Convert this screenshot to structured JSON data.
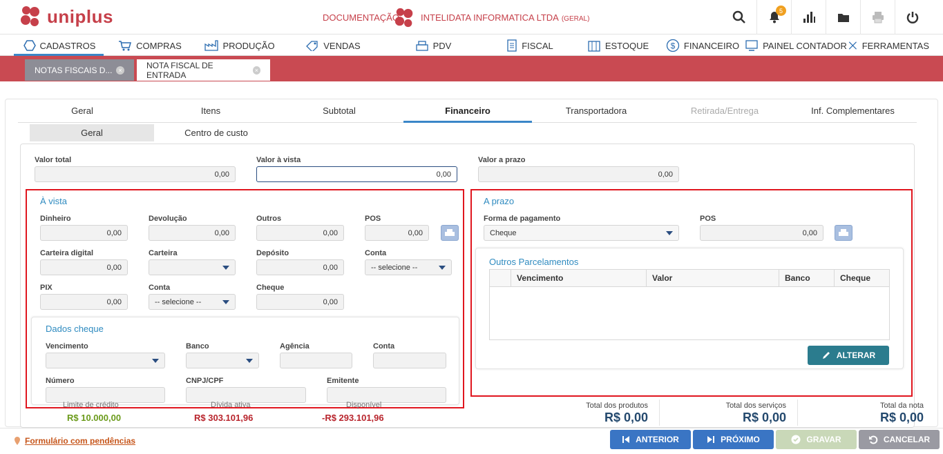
{
  "header": {
    "logo": "uniplus",
    "documentation": "DOCUMENTAÇÃO",
    "company": "INTELIDATA INFORMATICA LTDA",
    "company_tag": "(GERAL)",
    "notifications": "5"
  },
  "menu": [
    {
      "label": "CADASTROS",
      "icon": "hexagon-icon"
    },
    {
      "label": "COMPRAS",
      "icon": "cart-icon"
    },
    {
      "label": "PRODUÇÃO",
      "icon": "factory-icon"
    },
    {
      "label": "VENDAS",
      "icon": "tag-icon"
    },
    {
      "label": "PDV",
      "icon": "cash-register-icon"
    },
    {
      "label": "FISCAL",
      "icon": "document-icon"
    },
    {
      "label": "ESTOQUE",
      "icon": "box-icon"
    },
    {
      "label": "FINANCEIRO",
      "icon": "dollar-icon"
    },
    {
      "label": "PAINEL CONTADOR",
      "icon": "monitor-icon"
    },
    {
      "label": "FERRAMENTAS",
      "icon": "tools-icon"
    }
  ],
  "doc_tabs": {
    "inactive": "NOTAS FISCAIS D...",
    "active": "NOTA FISCAL DE ENTRADA"
  },
  "form_tabs": [
    "Geral",
    "Itens",
    "Subtotal",
    "Financeiro",
    "Transportadora",
    "Retirada/Entrega",
    "Inf. Complementares"
  ],
  "sub_tabs": [
    "Geral",
    "Centro de custo"
  ],
  "top_values": {
    "valor_total_label": "Valor total",
    "valor_total": "0,00",
    "valor_vista_label": "Valor à vista",
    "valor_vista": "0,00",
    "valor_prazo_label": "Valor a prazo",
    "valor_prazo": "0,00"
  },
  "avista": {
    "title": "À vista",
    "dinheiro_label": "Dinheiro",
    "dinheiro": "0,00",
    "devolucao_label": "Devolução",
    "devolucao": "0,00",
    "outros_label": "Outros",
    "outros": "0,00",
    "pos_label": "POS",
    "pos": "0,00",
    "carteira_digital_label": "Carteira digital",
    "carteira_digital": "0,00",
    "carteira_label": "Carteira",
    "deposito_label": "Depósito",
    "deposito": "0,00",
    "conta_label": "Conta",
    "conta": "-- selecione --",
    "pix_label": "PIX",
    "pix": "0,00",
    "conta2_label": "Conta",
    "conta2": "-- selecione --",
    "cheque_label": "Cheque",
    "cheque": "0,00"
  },
  "dados_cheque": {
    "title": "Dados cheque",
    "vencimento": "Vencimento",
    "banco": "Banco",
    "agencia": "Agência",
    "conta": "Conta",
    "numero": "Número",
    "cnpj": "CNPJ/CPF",
    "emitente": "Emitente"
  },
  "credit": {
    "limite_label": "Limite de crédito",
    "limite": "R$ 10.000,00",
    "divida_label": "Dívida ativa",
    "divida": "R$ 303.101,96",
    "disponivel_label": "Disponível",
    "disponivel": "-R$ 293.101,96"
  },
  "aprazo": {
    "title": "A prazo",
    "forma_label": "Forma de pagamento",
    "forma": "Cheque",
    "pos_label": "POS",
    "pos": "0,00",
    "outros_title": "Outros Parcelamentos",
    "columns": [
      "Vencimento",
      "Valor",
      "Banco",
      "Cheque"
    ],
    "alterar": "ALTERAR"
  },
  "totals": {
    "produtos_label": "Total dos produtos",
    "produtos": "R$ 0,00",
    "servicos_label": "Total dos serviços",
    "servicos": "R$ 0,00",
    "nota_label": "Total da nota",
    "nota": "R$ 0,00"
  },
  "footer": {
    "pendencias": "Formulário com pendências",
    "anterior": "ANTERIOR",
    "proximo": "PRÓXIMO",
    "gravar": "GRAVAR",
    "cancelar": "CANCELAR"
  },
  "colors": {
    "brand": "#c6404a",
    "tab_bar": "#c94a52",
    "section_title": "#2f8bc0",
    "button_primary": "#3a75c4",
    "button_teal": "#2b7c8e",
    "credit_green": "#6a9a1a",
    "credit_red": "#b8242c"
  }
}
